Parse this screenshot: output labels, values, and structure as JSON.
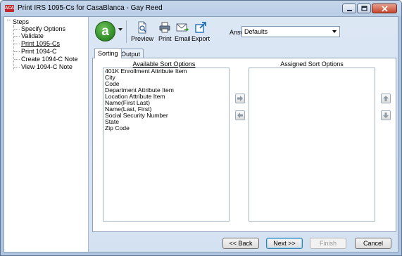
{
  "window": {
    "title": "Print IRS 1095-Cs for CasaBlanca - Gay Reed",
    "app_icon_text": "ACA"
  },
  "steps": {
    "root": "Steps",
    "items": [
      {
        "label": "Specify Options",
        "current": false
      },
      {
        "label": "Validate",
        "current": false
      },
      {
        "label": "Print 1095-Cs",
        "current": true
      },
      {
        "label": "Print 1094-C",
        "current": false
      },
      {
        "label": "Create 1094-C Note",
        "current": false
      },
      {
        "label": "View 1094-C Note",
        "current": false
      }
    ]
  },
  "toolbar": {
    "logo_letter": "a",
    "preview": "Preview",
    "print": "Print",
    "email": "Email",
    "export": "Export",
    "answers_label": "Answers:",
    "answers_value": "Defaults"
  },
  "tabs": [
    {
      "label": "Sorting",
      "active": true
    },
    {
      "label": "Output",
      "active": false
    }
  ],
  "sorting": {
    "available_heading": "Available Sort Options",
    "assigned_heading": "Assigned Sort Options",
    "available": [
      "401K Enrollment Attribute Item",
      "City",
      "Code",
      "Department Attribute Item",
      "Location Attribute Item",
      "Name(First Last)",
      "Name(Last, First)",
      "Social Security Number",
      "State",
      "Zip Code"
    ],
    "assigned": []
  },
  "footer": {
    "back": "<< Back",
    "next": "Next >>",
    "finish": "Finish",
    "cancel": "Cancel"
  },
  "colors": {
    "logo_green": "#2d8a25",
    "app_icon_red": "#c0282c",
    "close_button_red": "#c7462d"
  }
}
